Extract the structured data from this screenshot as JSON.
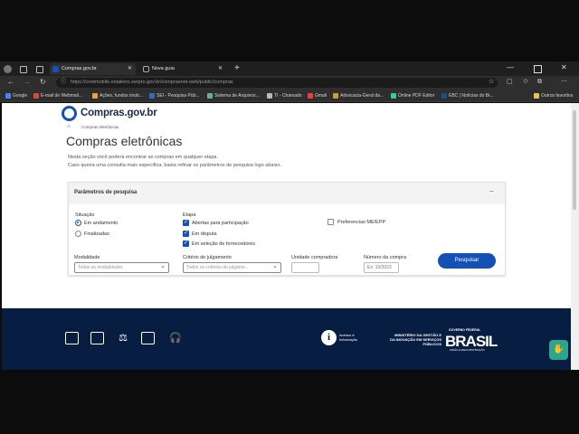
{
  "browser": {
    "tabs": [
      {
        "title": "Compras.gov.br",
        "active": true
      },
      {
        "title": "Nova guia",
        "active": false
      }
    ],
    "url": "https://cnetmobile.estaleiro.serpro.gov.br/comprasnet-web/public/compras",
    "bookmarks": [
      "Google",
      "E-mail de Webmail...",
      "Ações, fundos imob...",
      "SEI - Pesquisa Púb...",
      "Sistema de Arquivos...",
      "TI - Chamado",
      "Gmail",
      "Advocacia-Geral da...",
      "Online PDF Editor",
      "EBC | Notícias do Br...",
      "Outros favoritos"
    ]
  },
  "site": {
    "logo": "Compras.gov.br",
    "breadcrumb": "Compras eletrônicas",
    "title": "Compras eletrônicas",
    "intro": [
      "Nesta seção você poderá encontrar as compras em qualquer etapa.",
      "Caso queira uma consulta mais específica, basta refinar os parâmetros de pesquisa logo abaixo."
    ]
  },
  "filters": {
    "panel_title": "Parâmetros de pesquisa",
    "collapse_symbol": "−",
    "situacao": {
      "label": "Situação",
      "options": [
        {
          "label": "Em andamento",
          "selected": true
        },
        {
          "label": "Finalizadas",
          "selected": false
        }
      ]
    },
    "etapa": {
      "label": "Etapa",
      "options": [
        {
          "label": "Abertas para participação",
          "checked": true
        },
        {
          "label": "Em disputa",
          "checked": true
        },
        {
          "label": "Em seleção de fornecedores",
          "checked": true
        }
      ]
    },
    "preferencias": {
      "label": "Preferencias ME/EPP",
      "checked": false
    },
    "modalidade": {
      "label": "Modalidade",
      "value": "Todas as modalidades"
    },
    "criterio": {
      "label": "Critério de julgamento",
      "value": "Todos os critérios de julgame..."
    },
    "unidade": {
      "label": "Unidade compradora",
      "placeholder": ""
    },
    "numero": {
      "label": "Número da compra",
      "placeholder": "Ex: 10/2023"
    },
    "search_button": "Pesquisar"
  },
  "footer": {
    "icons": [
      "news-icon",
      "video-icon",
      "balance-icon",
      "scale-icon",
      "support-headset-icon"
    ],
    "info_text": "Acesso à Informação",
    "ministry": "MINISTÉRIO DA GESTÃO E DA INOVAÇÃO EM SERVIÇOS PÚBLICOS",
    "gov_top": "GOVERNO FEDERAL",
    "brasil": "BRASIL",
    "gov_bottom": "UNIÃO E RECONSTRUÇÃO"
  },
  "colors": {
    "primary": "#1351b4",
    "footer": "#071d41"
  }
}
